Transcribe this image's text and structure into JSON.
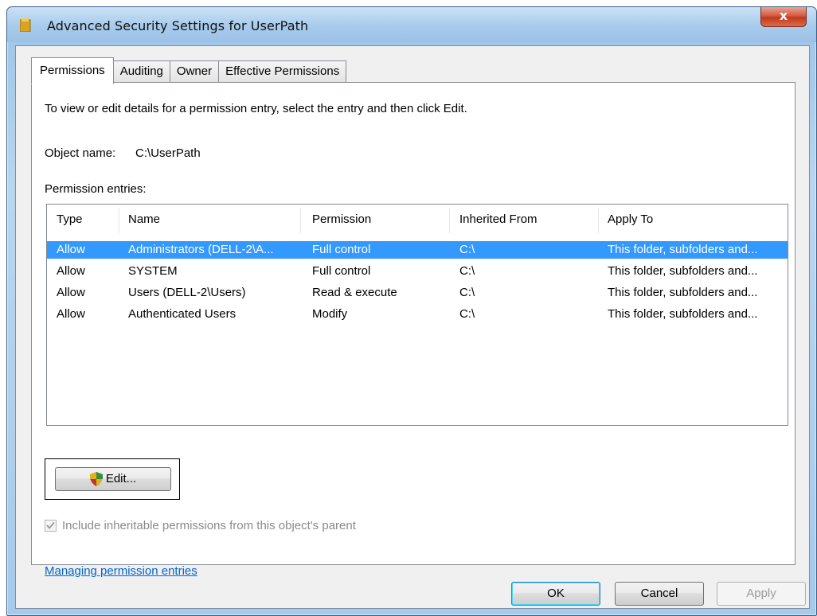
{
  "window": {
    "title": "Advanced Security Settings for UserPath",
    "close_label": "x"
  },
  "tabs": [
    {
      "label": "Permissions",
      "active": true
    },
    {
      "label": "Auditing",
      "active": false
    },
    {
      "label": "Owner",
      "active": false
    },
    {
      "label": "Effective Permissions",
      "active": false
    }
  ],
  "permissions_tab": {
    "instructions": "To view or edit details for a permission entry, select the entry and then click Edit.",
    "object_name_label": "Object name:",
    "object_name_value": "C:\\UserPath",
    "entries_label": "Permission entries:",
    "columns": [
      "Type",
      "Name",
      "Permission",
      "Inherited From",
      "Apply To"
    ],
    "rows": [
      {
        "type": "Allow",
        "name": "Administrators (DELL-2\\A...",
        "permission": "Full control",
        "inherited_from": "C:\\",
        "apply_to": "This folder, subfolders and...",
        "selected": true
      },
      {
        "type": "Allow",
        "name": "SYSTEM",
        "permission": "Full control",
        "inherited_from": "C:\\",
        "apply_to": "This folder, subfolders and...",
        "selected": false
      },
      {
        "type": "Allow",
        "name": "Users (DELL-2\\Users)",
        "permission": "Read & execute",
        "inherited_from": "C:\\",
        "apply_to": "This folder, subfolders and...",
        "selected": false
      },
      {
        "type": "Allow",
        "name": "Authenticated Users",
        "permission": "Modify",
        "inherited_from": "C:\\",
        "apply_to": "This folder, subfolders and...",
        "selected": false
      }
    ],
    "edit_button": "Edit...",
    "inherit_checkbox": {
      "label": "Include inheritable permissions from this object's parent",
      "checked": true,
      "enabled": false
    },
    "help_link": "Managing permission entries"
  },
  "buttons": {
    "ok": "OK",
    "cancel": "Cancel",
    "apply": "Apply"
  },
  "colors": {
    "selection": "#3399ff",
    "link": "#0066cc",
    "close_button": "#c2391c"
  }
}
